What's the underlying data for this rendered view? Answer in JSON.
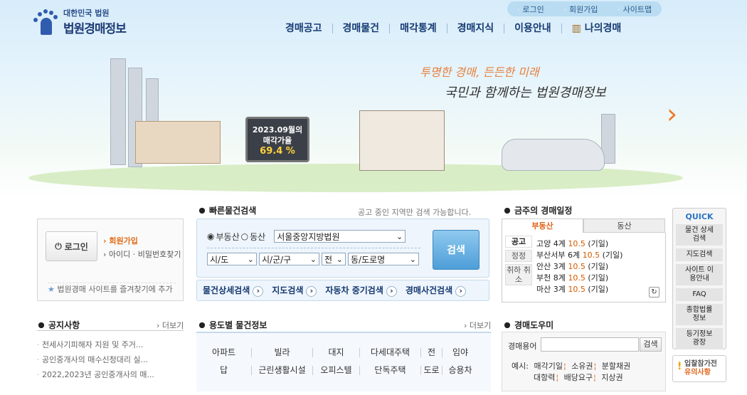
{
  "header": {
    "logo_sub": "대한민국 법원",
    "logo_main": "법원경매정보",
    "util": [
      "로그인",
      "회원가입",
      "사이트맵"
    ],
    "gnb": [
      "경매공고",
      "경매물건",
      "매각통계",
      "경매지식",
      "이용안내",
      "나의경매"
    ]
  },
  "hero": {
    "slogan1": "투명한 경매, 든든한 미래",
    "slogan2": "국민과 함께하는 법원경매정보",
    "billboard_line1": "2023.09월의",
    "billboard_line2": "매각가율",
    "billboard_rate": "69.4 %"
  },
  "login": {
    "button": "로그인",
    "join": "회원가입",
    "find": "아이디 · 비밀번호찾기",
    "favorite": "법원경매 사이트를 즐겨찾기에 추가"
  },
  "quick_search": {
    "title": "빠른물건검색",
    "note": "공고 중인 지역만 검색 가능합니다.",
    "radio_realestate": "부동산",
    "radio_movable": "동산",
    "court": "서울중앙지방법원",
    "sido": "시/도",
    "sigungu": "시/군/구",
    "dong_select": "전",
    "road": "동/도로명",
    "search_button": "검색",
    "links": [
      "물건상세검색",
      "지도검색",
      "자동차 중기검색",
      "경매사건검색"
    ]
  },
  "schedule": {
    "title": "금주의 경매일정",
    "tabs": [
      "부동산",
      "동산"
    ],
    "types": [
      "공고",
      "정정",
      "취하 취소"
    ],
    "items": [
      {
        "place": "고양 4계",
        "date": "10.5",
        "kind": "(기일)"
      },
      {
        "place": "부산서부 6계",
        "date": "10.5",
        "kind": "(기일)"
      },
      {
        "place": "안산 3계",
        "date": "10.5",
        "kind": "(기일)"
      },
      {
        "place": "부천 8계",
        "date": "10.5",
        "kind": "(기일)"
      },
      {
        "place": "마산 3계",
        "date": "10.5",
        "kind": "(기일)"
      }
    ]
  },
  "side": {
    "quick_title": "QUICK",
    "items": [
      "물건 상세검색",
      "지도검색",
      "사이트 이용안내",
      "FAQ",
      "종합법률 정보",
      "등기정보 광장"
    ],
    "notice_line1": "입찰참가전",
    "notice_line2": "유의사항"
  },
  "notice": {
    "title": "공지사항",
    "more": "더보기",
    "items": [
      "전세사기피해자 지원 및 주거...",
      "공인중개사의 매수신청대리 실...",
      "2022,2023년 공인중개사의 매..."
    ]
  },
  "usage": {
    "title": "용도별 물건정보",
    "more": "더보기",
    "row1": [
      "아파트",
      "빌라",
      "대지",
      "다세대주택",
      "전",
      "임야"
    ],
    "row2": [
      "답",
      "근린생활시설",
      "오피스텔",
      "단독주택",
      "도로",
      "승용차"
    ]
  },
  "helper": {
    "title": "경매도우미",
    "label": "경매용어",
    "button": "검색",
    "example_label": "예시:",
    "examples": [
      "매각기일",
      "소유권",
      "분할채권",
      "대항력",
      "배당요구",
      "지상권"
    ]
  }
}
